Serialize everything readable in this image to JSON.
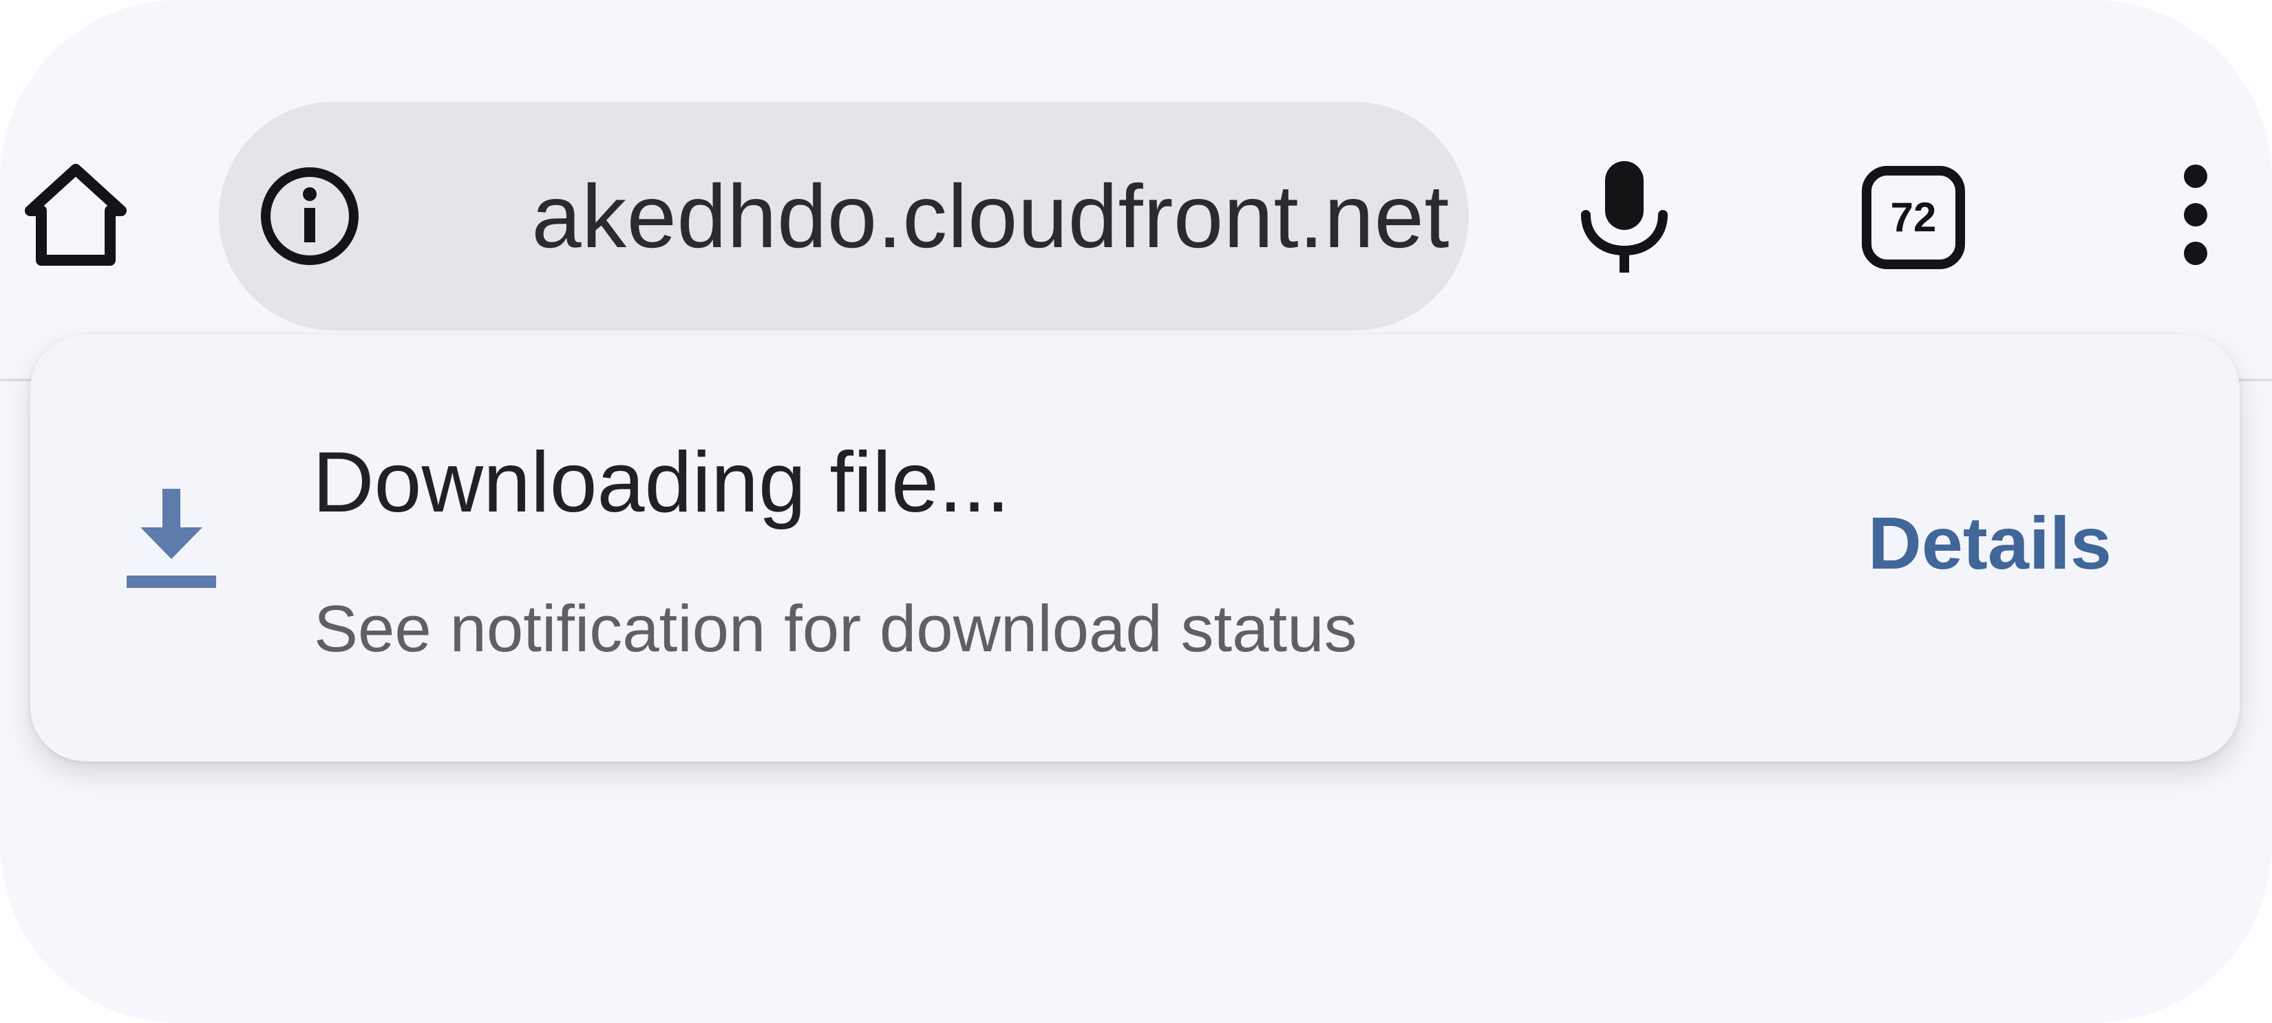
{
  "colors": {
    "page_background": "#f6f7fc",
    "omnibox_background": "#e4e5ea",
    "icon_color": "#141416",
    "snackbar_background": "#f4f5fa",
    "accent_link": "#416699",
    "download_icon": "#5d7bab"
  },
  "toolbar": {
    "home_icon": "home-icon",
    "site_info_icon": "info-icon",
    "url_text": "akedhdo.cloudfront.net",
    "mic_icon": "mic-icon",
    "tab_count": "72",
    "menu_icon": "more-vert-icon"
  },
  "download_snackbar": {
    "icon": "download-icon",
    "title": "Downloading file...",
    "subtitle": "See notification for download status",
    "action_label": "Details"
  }
}
